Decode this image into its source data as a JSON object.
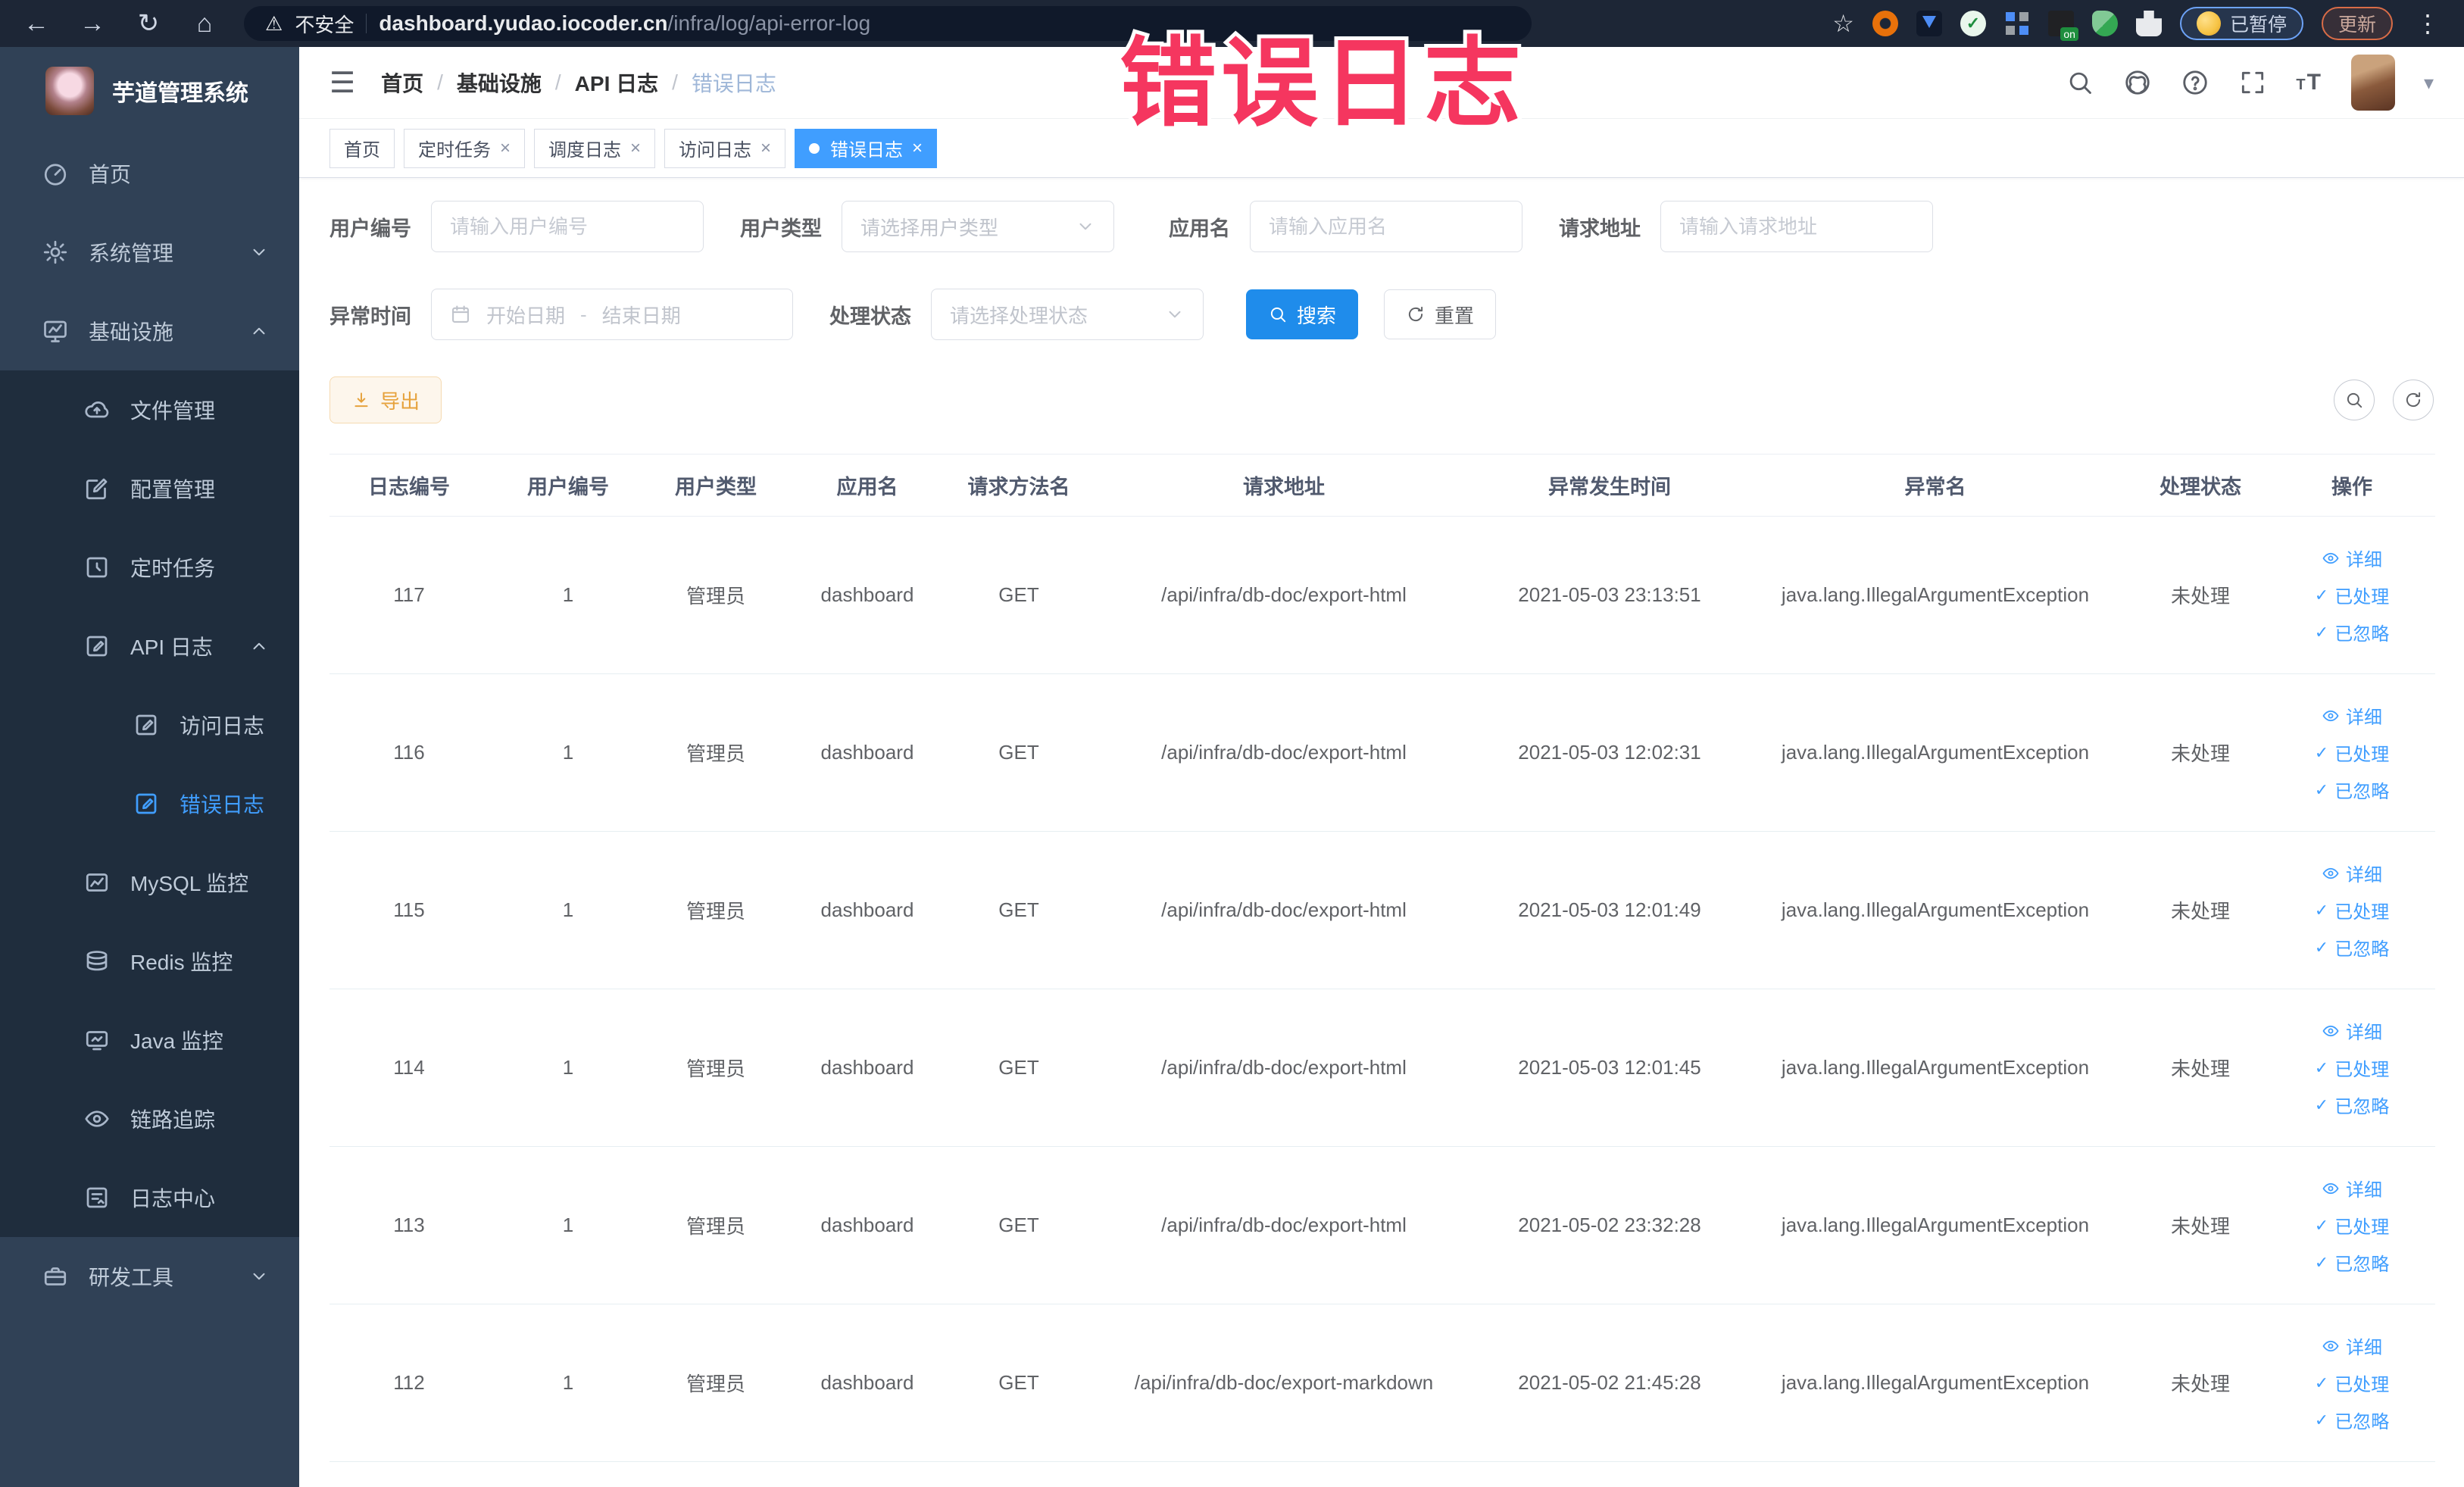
{
  "colors": {
    "accent": "#409eff",
    "active_tab": "#409eff",
    "warning": "#e6a23c",
    "watermark": "#f5365f",
    "sidebar_bg": "#304156",
    "submenu_bg": "#1f2d3d"
  },
  "icons": {
    "back": "←",
    "forward": "→",
    "reload": "↻",
    "home": "⌂",
    "warning": "⚠",
    "star": "☆",
    "dots": "⋮",
    "hamburger": "☰",
    "gear": "⚙",
    "check": "✓",
    "caret_down": "▾",
    "close": "×",
    "crumb_sep": "/",
    "range_sep": "-",
    "font_small": "T",
    "font_big": "T"
  },
  "browser": {
    "security_label": "不安全",
    "url_domain": "dashboard.yudao.iocoder.cn",
    "url_path": "/infra/log/api-error-log",
    "profile_badge": "已暂停",
    "update_button": "更新"
  },
  "watermark": "错误日志",
  "sidebar": {
    "title": "芋道管理系统",
    "items": [
      {
        "label": "首页"
      },
      {
        "label": "系统管理"
      },
      {
        "label": "基础设施"
      },
      {
        "label": "文件管理"
      },
      {
        "label": "配置管理"
      },
      {
        "label": "定时任务"
      },
      {
        "label": "API 日志"
      },
      {
        "label": "访问日志"
      },
      {
        "label": "错误日志"
      },
      {
        "label": "MySQL 监控"
      },
      {
        "label": "Redis 监控"
      },
      {
        "label": "Java 监控"
      },
      {
        "label": "链路追踪"
      },
      {
        "label": "日志中心"
      },
      {
        "label": "研发工具"
      }
    ]
  },
  "header": {
    "breadcrumb": [
      "首页",
      "基础设施",
      "API 日志",
      "错误日志"
    ]
  },
  "tabs": [
    {
      "label": "首页"
    },
    {
      "label": "定时任务"
    },
    {
      "label": "调度日志"
    },
    {
      "label": "访问日志"
    },
    {
      "label": "错误日志"
    }
  ],
  "filters": {
    "user_id": {
      "label": "用户编号",
      "placeholder": "请输入用户编号"
    },
    "user_type": {
      "label": "用户类型",
      "placeholder": "请选择用户类型"
    },
    "app_name": {
      "label": "应用名",
      "placeholder": "请输入应用名"
    },
    "request_url": {
      "label": "请求地址",
      "placeholder": "请输入请求地址"
    },
    "exception_time": {
      "label": "异常时间",
      "start_placeholder": "开始日期",
      "end_placeholder": "结束日期"
    },
    "process_status": {
      "label": "处理状态",
      "placeholder": "请选择处理状态"
    },
    "search_button": "搜索",
    "reset_button": "重置"
  },
  "toolbar": {
    "export_button": "导出"
  },
  "table": {
    "columns": [
      "日志编号",
      "用户编号",
      "用户类型",
      "应用名",
      "请求方法名",
      "请求地址",
      "异常发生时间",
      "异常名",
      "处理状态",
      "操作"
    ],
    "actions": {
      "detail": "详细",
      "processed": "已处理",
      "ignored": "已忽略"
    },
    "rows": [
      {
        "id": "117",
        "user_id": "1",
        "user_type": "管理员",
        "app": "dashboard",
        "method": "GET",
        "url": "/api/infra/db-doc/export-html",
        "time": "2021-05-03 23:13:51",
        "exception": "java.lang.IllegalArgumentException",
        "status": "未处理"
      },
      {
        "id": "116",
        "user_id": "1",
        "user_type": "管理员",
        "app": "dashboard",
        "method": "GET",
        "url": "/api/infra/db-doc/export-html",
        "time": "2021-05-03 12:02:31",
        "exception": "java.lang.IllegalArgumentException",
        "status": "未处理"
      },
      {
        "id": "115",
        "user_id": "1",
        "user_type": "管理员",
        "app": "dashboard",
        "method": "GET",
        "url": "/api/infra/db-doc/export-html",
        "time": "2021-05-03 12:01:49",
        "exception": "java.lang.IllegalArgumentException",
        "status": "未处理"
      },
      {
        "id": "114",
        "user_id": "1",
        "user_type": "管理员",
        "app": "dashboard",
        "method": "GET",
        "url": "/api/infra/db-doc/export-html",
        "time": "2021-05-03 12:01:45",
        "exception": "java.lang.IllegalArgumentException",
        "status": "未处理"
      },
      {
        "id": "113",
        "user_id": "1",
        "user_type": "管理员",
        "app": "dashboard",
        "method": "GET",
        "url": "/api/infra/db-doc/export-html",
        "time": "2021-05-02 23:32:28",
        "exception": "java.lang.IllegalArgumentException",
        "status": "未处理"
      },
      {
        "id": "112",
        "user_id": "1",
        "user_type": "管理员",
        "app": "dashboard",
        "method": "GET",
        "url": "/api/infra/db-doc/export-markdown",
        "time": "2021-05-02 21:45:28",
        "exception": "java.lang.IllegalArgumentException",
        "status": "未处理"
      }
    ]
  }
}
